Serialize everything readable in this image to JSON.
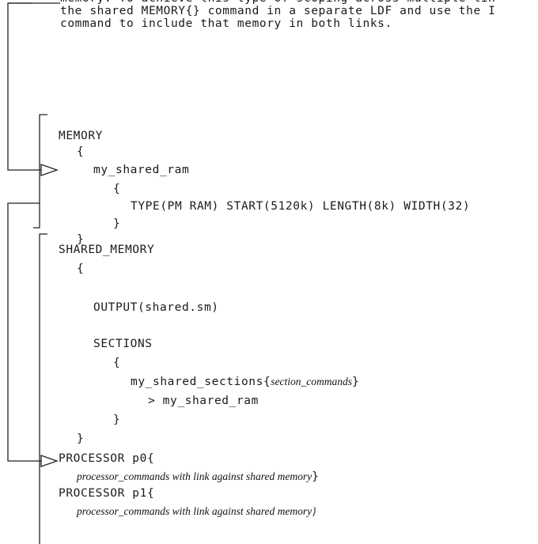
{
  "intro_lines": [
    "memory. To achieve this type of scoping across multiple lin",
    "the shared MEMORY{} command in a separate LDF and use the I",
    "command to include that memory in both links."
  ],
  "code": {
    "memory_kw": "MEMORY",
    "brace_open": "{",
    "brace_close": "}",
    "ram_name": "my_shared_ram",
    "ram_def": "TYPE(PM RAM) START(5120k) LENGTH(8k) WIDTH(32)",
    "shared_memory_kw": "SHARED_MEMORY",
    "output_cmd": "OUTPUT(shared.sm)",
    "sections_kw": "SECTIONS",
    "shared_sections": "my_shared_sections{",
    "section_commands": "section_commands",
    "map_to_ram": "> my_shared_ram",
    "processor_p0": "PROCESSOR p0{",
    "processor_p1": "PROCESSOR p1{",
    "p0_commands": "processor_commands with link against shared memory",
    "p1_commands": "processor_commands with link against shared memory}",
    "close_inline": "}"
  }
}
